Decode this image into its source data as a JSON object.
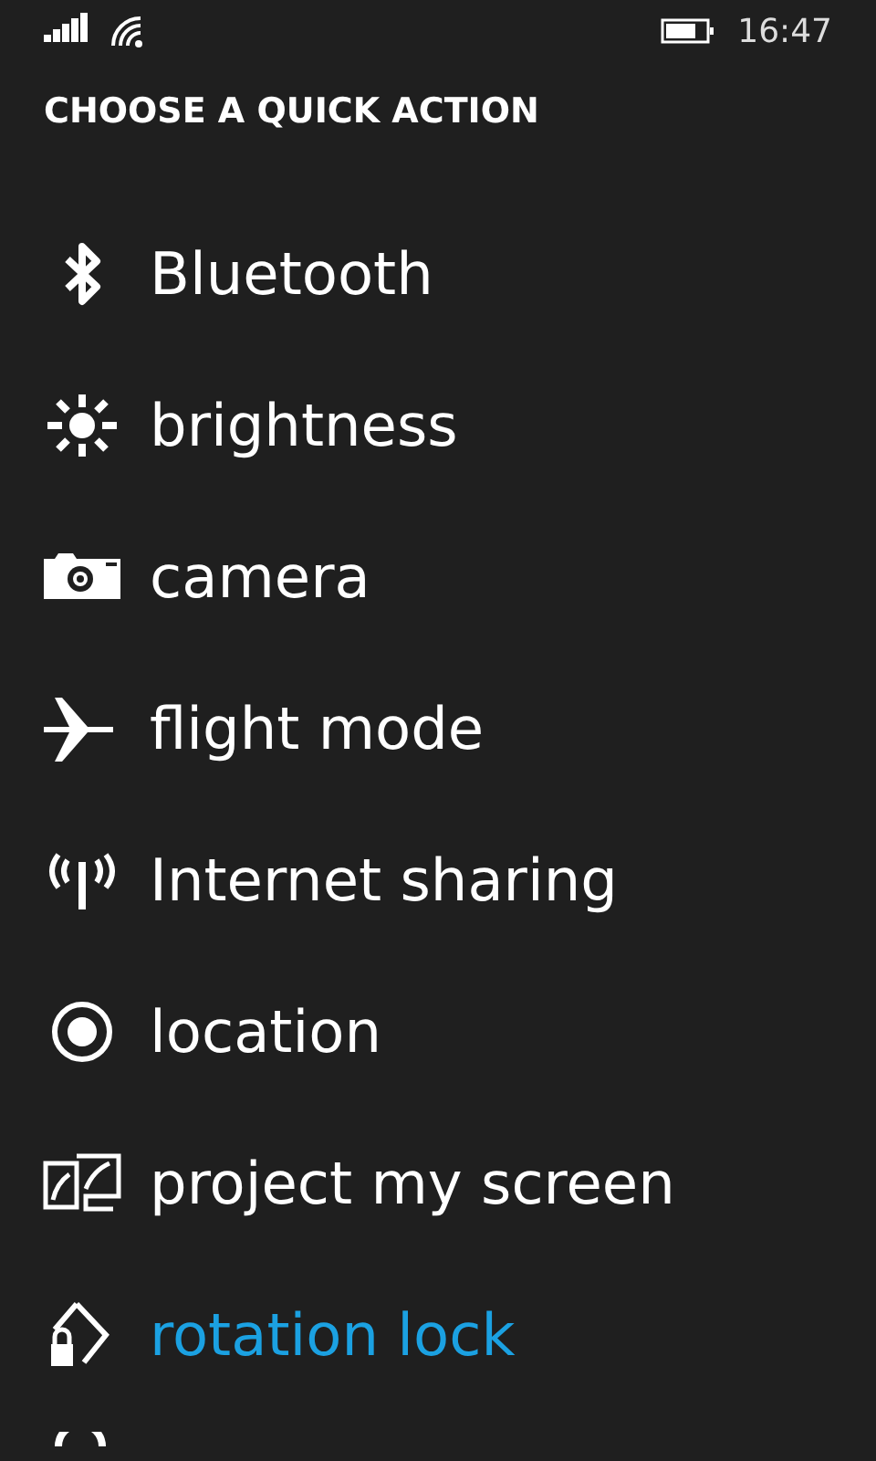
{
  "status_bar": {
    "time": "16:47"
  },
  "header": "CHOOSE A QUICK ACTION",
  "actions": [
    {
      "kind": "bluetooth",
      "label": "Bluetooth",
      "selected": false
    },
    {
      "kind": "brightness",
      "label": "brightness",
      "selected": false
    },
    {
      "kind": "camera",
      "label": "camera",
      "selected": false
    },
    {
      "kind": "flight",
      "label": "flight mode",
      "selected": false
    },
    {
      "kind": "sharing",
      "label": "Internet sharing",
      "selected": false
    },
    {
      "kind": "location",
      "label": "location",
      "selected": false
    },
    {
      "kind": "project",
      "label": "project my screen",
      "selected": false
    },
    {
      "kind": "rotation",
      "label": "rotation lock",
      "selected": true
    },
    {
      "kind": "partial"
    }
  ]
}
